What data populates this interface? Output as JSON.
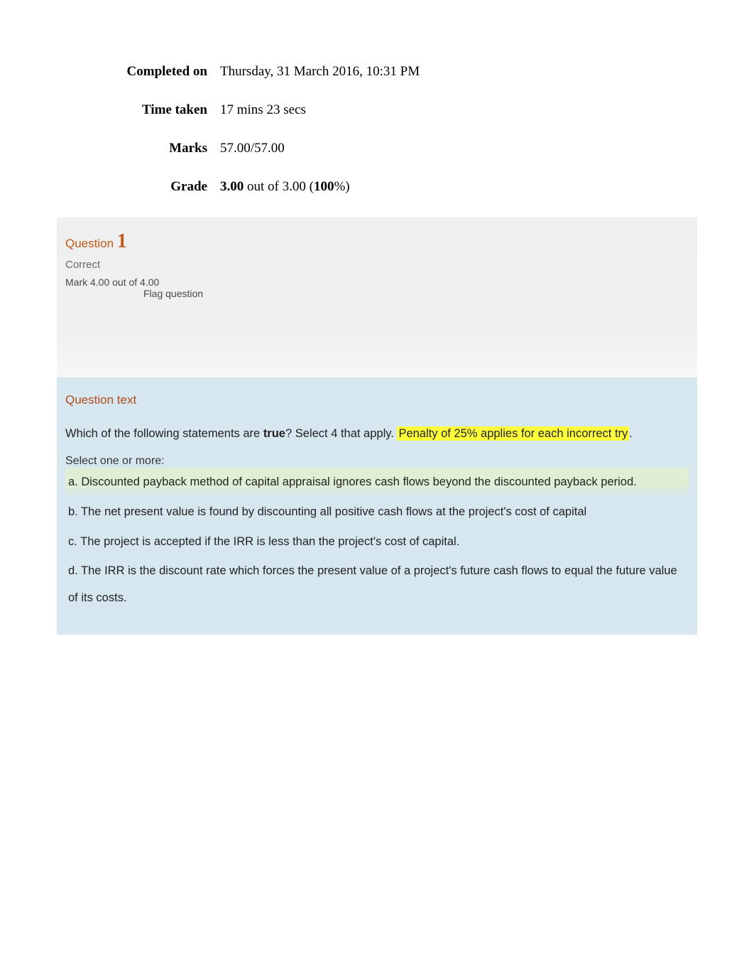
{
  "summary": {
    "completed_on_label": "Completed on",
    "completed_on_value": "Thursday, 31 March 2016, 10:31 PM",
    "time_taken_label": "Time taken",
    "time_taken_value": "17 mins 23 secs",
    "marks_label": "Marks",
    "marks_value": "57.00/57.00",
    "grade_label": "Grade",
    "grade_val_bold1": "3.00",
    "grade_mid": " out of 3.00 (",
    "grade_val_bold2": "100",
    "grade_end": "%)"
  },
  "question": {
    "label": "Question ",
    "number": "1",
    "status": "Correct",
    "mark": "Mark 4.00 out of 4.00",
    "flag": "Flag question"
  },
  "qtext": {
    "heading": "Question text",
    "prompt_pre": "Which of the following statements are ",
    "prompt_true": "true",
    "prompt_post": "? Select 4 that apply.  ",
    "penalty": "Penalty of 25% applies for each incorrect try",
    "penalty_dot": ".",
    "select_label": "Select one or more:",
    "options": {
      "a": "a. Discounted payback method of capital appraisal ignores cash flows beyond the discounted payback period.",
      "b": "b. The net present value is found by discounting all positive cash flows at the project's cost of capital",
      "c": "c. The project is accepted if the IRR is less than the project's cost of capital.",
      "d": "d. The IRR is the discount rate which forces the present value of a project's future cash flows to equal the future value of its costs."
    }
  }
}
